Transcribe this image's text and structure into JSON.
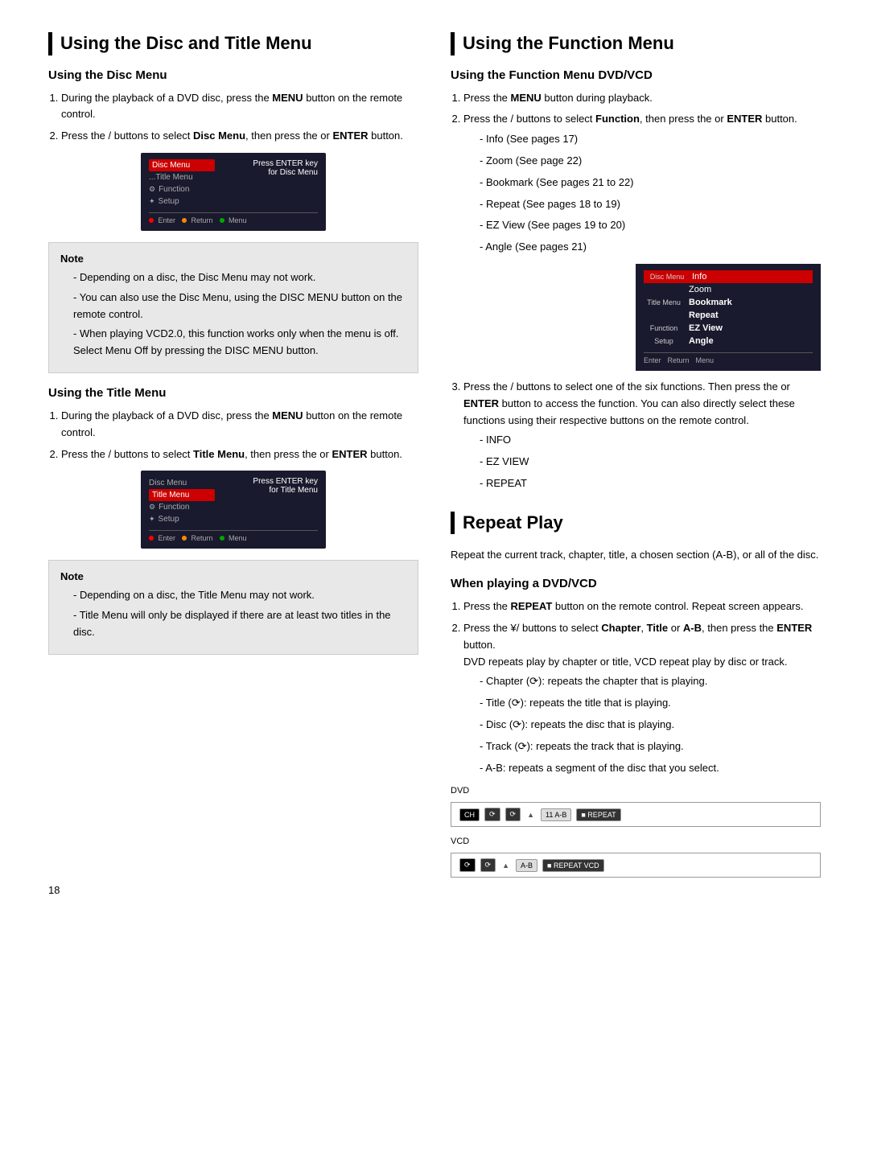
{
  "left": {
    "main_title": "Using the Disc and Title Menu",
    "disc_menu": {
      "title": "Using the Disc Menu",
      "step1": "During the playback of a DVD disc, press the ",
      "step1_bold": "MENU",
      "step1_end": " button on the remote control.",
      "step2_start": "Press the  /  buttons to select ",
      "step2_bold": "Disc Menu",
      "step2_end": ", then press the or ",
      "step2_bold2": "ENTER",
      "step2_end2": " button.",
      "screen_label": "Press ENTER key for Disc Menu",
      "menu_items": [
        "Disc Menu",
        "...Title Menu",
        "Function",
        "Setup"
      ],
      "screen_bottom": [
        "● Enter",
        "● Return",
        "● Menu"
      ]
    },
    "note1": {
      "title": "Note",
      "items": [
        "Depending on a disc, the Disc Menu may not work.",
        "You can also use the Disc Menu, using the DISC MENU button on the remote control.",
        "When playing VCD2.0, this function works only when the menu is off. Select Menu Off by pressing the DISC MENU button."
      ]
    },
    "title_menu": {
      "title": "Using the Title Menu",
      "step1": "During the playback of a DVD disc, press the ",
      "step1_bold": "MENU",
      "step1_end": " button on the remote control.",
      "step2_start": "Press the  /  buttons to select ",
      "step2_bold": "Title Menu",
      "step2_end": ", then press the or ",
      "step2_bold2": "ENTER",
      "step2_end2": " button.",
      "screen_label": "Press ENTER key for Title Menu",
      "menu_items": [
        "Disc Menu",
        "Title Menu",
        "Function",
        "Setup"
      ],
      "screen_bottom": [
        "● Enter",
        "● Return",
        "● Menu"
      ]
    },
    "note2": {
      "title": "Note",
      "items": [
        "Depending on a disc, the Title Menu may not work.",
        "Title Menu will only be displayed if there are at least two titles in the disc."
      ]
    }
  },
  "right": {
    "function_menu_title": "Using the Function Menu",
    "dvd_vcd": {
      "title": "Using the Function Menu DVD/VCD",
      "step1": "Press the ",
      "step1_bold": "MENU",
      "step1_end": " button during playback.",
      "step2_start": "Press the  /  buttons to select ",
      "step2_bold": "Function",
      "step2_end": ", then press the or ",
      "step2_bold2": "ENTER",
      "step2_end2": " button.",
      "step2_list": [
        "Info (See pages 17)",
        "Zoom (See page 22)",
        "Bookmark (See pages 21 to 22)",
        "Repeat (See pages 18 to 19)",
        "EZ View (See pages 19 to 20)",
        "Angle (See pages 21)"
      ],
      "func_menu_items": [
        {
          "icon": "Disc Menu",
          "text": "Info",
          "bold": false,
          "highlighted": false
        },
        {
          "icon": "",
          "text": "Zoom",
          "bold": false,
          "highlighted": false
        },
        {
          "icon": "Title Menu",
          "text": "Bookmark",
          "bold": true,
          "highlighted": false
        },
        {
          "icon": "",
          "text": "Repeat",
          "bold": true,
          "highlighted": false
        },
        {
          "icon": "Function",
          "text": "EZ View",
          "bold": true,
          "highlighted": true
        },
        {
          "icon": "Setup",
          "text": "Angle",
          "bold": true,
          "highlighted": false
        }
      ],
      "func_bottom": [
        "● Enter",
        "● Return",
        "● Menu"
      ],
      "step3_start": "Press the  /  buttons to select one of the six functions. Then press the  or ",
      "step3_bold": "ENTER",
      "step3_end": " button to access the function. You can also directly select these functions using their respective buttons on the remote control.",
      "step3_list": [
        "INFO",
        "EZ VIEW",
        "REPEAT"
      ]
    },
    "repeat_play": {
      "title": "Repeat Play",
      "intro": "Repeat the current track, chapter, title, a chosen section (A-B), or all of the disc.",
      "dvd_vcd_title": "When playing a DVD/VCD",
      "step1": "Press the ",
      "step1_bold": "REPEAT",
      "step1_end": " button on the remote control. Repeat screen appears.",
      "step2_start": "Press the ¥/  buttons to select ",
      "step2_bold": "Chapter",
      "step2_sep1": ", ",
      "step2_bold2": "Title",
      "step2_sep2": " or ",
      "step2_bold3": "A-B",
      "step2_end": ", then press the ",
      "step2_bold4": "ENTER",
      "step2_end2": " button.",
      "step2_note": "DVD repeats play by chapter or title, VCD repeat play by disc or track.",
      "bullets": [
        "Chapter (⟳): repeats the chapter that is playing.",
        "Title (⟳): repeats the title that is playing.",
        "Disc (⟳): repeats the disc that is playing.",
        "Track (⟳): repeats the track that is playing.",
        "A-B: repeats a segment of the disc that you select."
      ],
      "dvd_label": "DVD",
      "vcd_label": "VCD"
    }
  },
  "page_number": "18"
}
